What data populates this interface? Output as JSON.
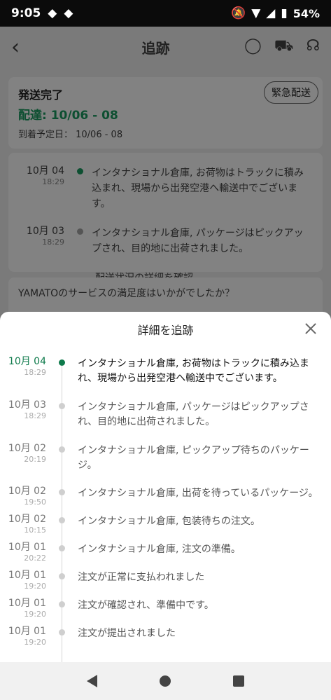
{
  "status_bar": {
    "time": "9:05",
    "battery": "54%"
  },
  "background": {
    "title": "追跡",
    "card1": {
      "status": "発送完了",
      "delivery": "配達: 10/06 - 08",
      "eta": "到着予定日： 10/06 - 08",
      "urgent": "緊急配送"
    },
    "events": [
      {
        "date": "10月 04",
        "time": "18:29",
        "text": "インタナショナル倉庫, お荷物はトラックに積み込まれ、現場から出発空港へ輸送中でございます。"
      },
      {
        "date": "10月 03",
        "time": "18:29",
        "text": "インタナショナル倉庫, パッケージはピックアップされ、目的地に出荷されました。"
      }
    ],
    "details_link": "配送状況の詳細を確認",
    "survey": "YAMATOのサービスの満足度はいかがでしたか？"
  },
  "sheet": {
    "title": "詳細を追跡",
    "events": [
      {
        "date": "10月 04",
        "time": "18:29",
        "text": "インタナショナル倉庫, お荷物はトラックに積み込まれ、現場から出発空港へ輸送中でございます。"
      },
      {
        "date": "10月 03",
        "time": "18:29",
        "text": "インタナショナル倉庫, パッケージはピックアップされ、目的地に出荷されました。"
      },
      {
        "date": "10月 02",
        "time": "20:19",
        "text": "インタナショナル倉庫, ピックアップ待ちのパッケージ。"
      },
      {
        "date": "10月 02",
        "time": "19:50",
        "text": "インタナショナル倉庫, 出荷を待っているパッケージ。"
      },
      {
        "date": "10月 02",
        "time": "10:15",
        "text": "インタナショナル倉庫, 包装待ちの注文。"
      },
      {
        "date": "10月 01",
        "time": "20:22",
        "text": "インタナショナル倉庫, 注文の準備。"
      },
      {
        "date": "10月 01",
        "time": "19:20",
        "text": "注文が正常に支払われました"
      },
      {
        "date": "10月 01",
        "time": "19:20",
        "text": "注文が確認され、準備中です。"
      },
      {
        "date": "10月 01",
        "time": "19:20",
        "text": "注文が提出されました"
      }
    ]
  },
  "colors": {
    "accent": "#0e7a4b"
  },
  "icons": [
    "whatsapp-icon",
    "cart-icon",
    "support-icon",
    "back-arrow-icon",
    "close-icon"
  ]
}
